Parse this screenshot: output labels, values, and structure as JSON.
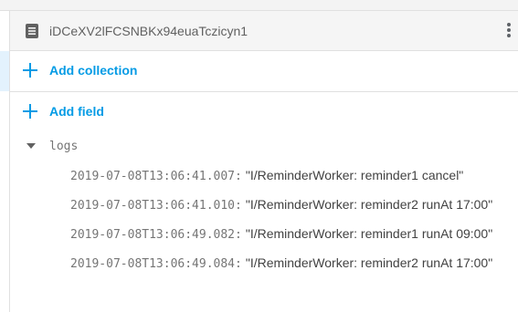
{
  "document": {
    "title": "iDCeXV2lFCSNBKx94euaTczicyn1"
  },
  "actions": {
    "add_collection": "Add collection",
    "add_field": "Add field"
  },
  "field": {
    "name": "logs",
    "entries": [
      {
        "key": "2019-07-08T13:06:41.007:",
        "value": "\"I/ReminderWorker: reminder1 cancel\""
      },
      {
        "key": "2019-07-08T13:06:41.010:",
        "value": "\"I/ReminderWorker: reminder2 runAt 17:00\""
      },
      {
        "key": "2019-07-08T13:06:49.082:",
        "value": "\"I/ReminderWorker: reminder1 runAt 09:00\""
      },
      {
        "key": "2019-07-08T13:06:49.084:",
        "value": "\"I/ReminderWorker: reminder2 runAt 17:00\""
      }
    ]
  },
  "colors": {
    "accent": "#039be5",
    "header_bg": "#f5f5f5",
    "border": "#e0e0e0"
  },
  "icons": {
    "document": "document-icon",
    "more": "more-vert-icon",
    "add": "plus-icon",
    "expand": "caret-down-icon"
  }
}
